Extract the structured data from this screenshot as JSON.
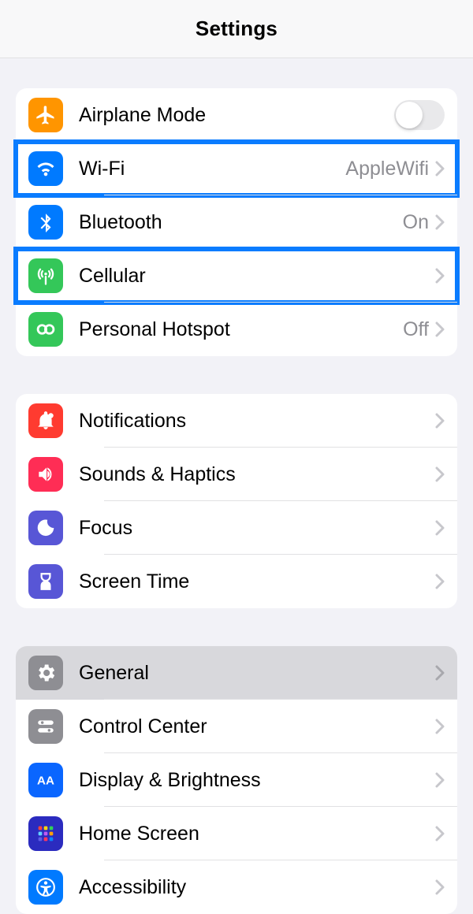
{
  "header": {
    "title": "Settings"
  },
  "group1": {
    "airplane": {
      "label": "Airplane Mode"
    },
    "wifi": {
      "label": "Wi-Fi",
      "value": "AppleWifi"
    },
    "bluetooth": {
      "label": "Bluetooth",
      "value": "On"
    },
    "cellular": {
      "label": "Cellular"
    },
    "hotspot": {
      "label": "Personal Hotspot",
      "value": "Off"
    }
  },
  "group2": {
    "notifications": {
      "label": "Notifications"
    },
    "sounds": {
      "label": "Sounds & Haptics"
    },
    "focus": {
      "label": "Focus"
    },
    "screentime": {
      "label": "Screen Time"
    }
  },
  "group3": {
    "general": {
      "label": "General"
    },
    "controlcenter": {
      "label": "Control Center"
    },
    "display": {
      "label": "Display & Brightness"
    },
    "homescreen": {
      "label": "Home Screen"
    },
    "accessibility": {
      "label": "Accessibility"
    }
  }
}
